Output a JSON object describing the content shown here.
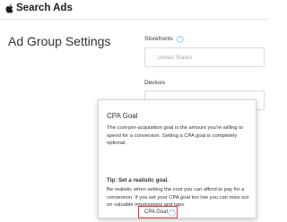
{
  "header": {
    "brand_label": "Search Ads",
    "logo_icon": "apple-icon"
  },
  "page": {
    "title": "Ad Group Settings"
  },
  "storefronts": {
    "label": "Storefronts",
    "value": "United States",
    "help_icon": "info-icon"
  },
  "devices": {
    "label": "Devices"
  },
  "tooltip": {
    "title": "CPA Goal",
    "body": "The cost-per-acquisition goal is the amount you’re willing to spend for a conversion. Setting a CPA goal is completely optional.",
    "tip_title": "Tip: Set a realistic goal.",
    "tip_body": "Be realistic when setting the cost you can afford to pay for a conversion. If you set your CPA goal too low you can miss out on valuable impressions and taps."
  },
  "cpa_goal": {
    "label": "CPA Goal",
    "help_icon": "info-icon",
    "highlight_color": "#e63232"
  },
  "colors": {
    "info_icon": "#9ad0f5",
    "link": "#2b82d9"
  }
}
